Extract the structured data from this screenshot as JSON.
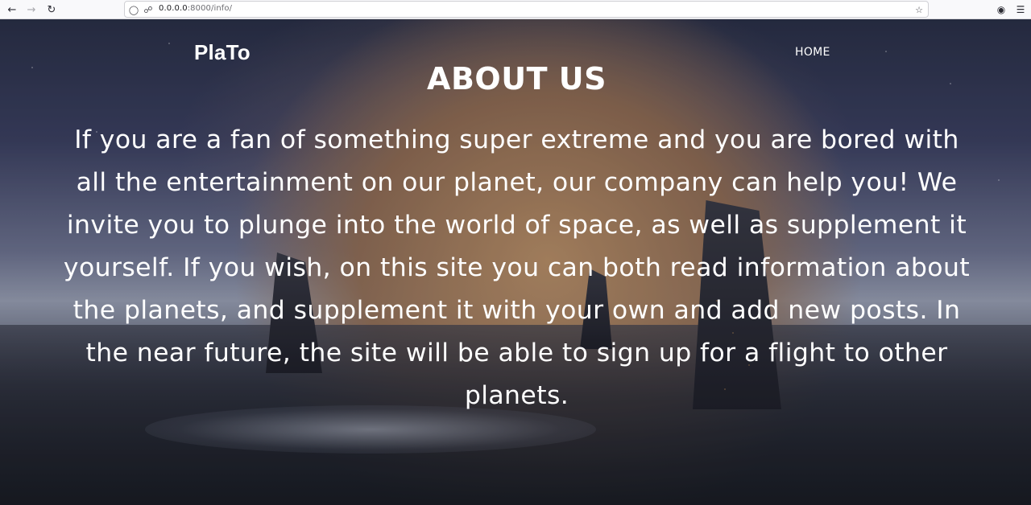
{
  "browser": {
    "url_host": "0.0.0.0",
    "url_path": ":8000/info/",
    "icons": {
      "back": "arrow-left-icon",
      "forward": "arrow-right-icon",
      "reload": "reload-icon",
      "shield": "shield-icon",
      "insecure": "insecure-lock-icon",
      "bookmark": "star-icon",
      "pocket": "pocket-icon",
      "menu": "hamburger-menu-icon"
    }
  },
  "site": {
    "brand": "PlaTo",
    "nav": {
      "home": "HOME"
    }
  },
  "page": {
    "heading": "ABOUT US",
    "body": "If you are a fan of something super extreme and you are bored with all the entertainment on our planet, our company can help you! We invite you to plunge into the world of space, as well as supplement it yourself. If you wish, on this site you can both read information about the planets, and supplement it with your own and add new posts. In the near future, the site will be able to sign up for a flight to other planets."
  },
  "colors": {
    "text": "#ffffff",
    "toolbar_bg": "#f9f9fb"
  }
}
